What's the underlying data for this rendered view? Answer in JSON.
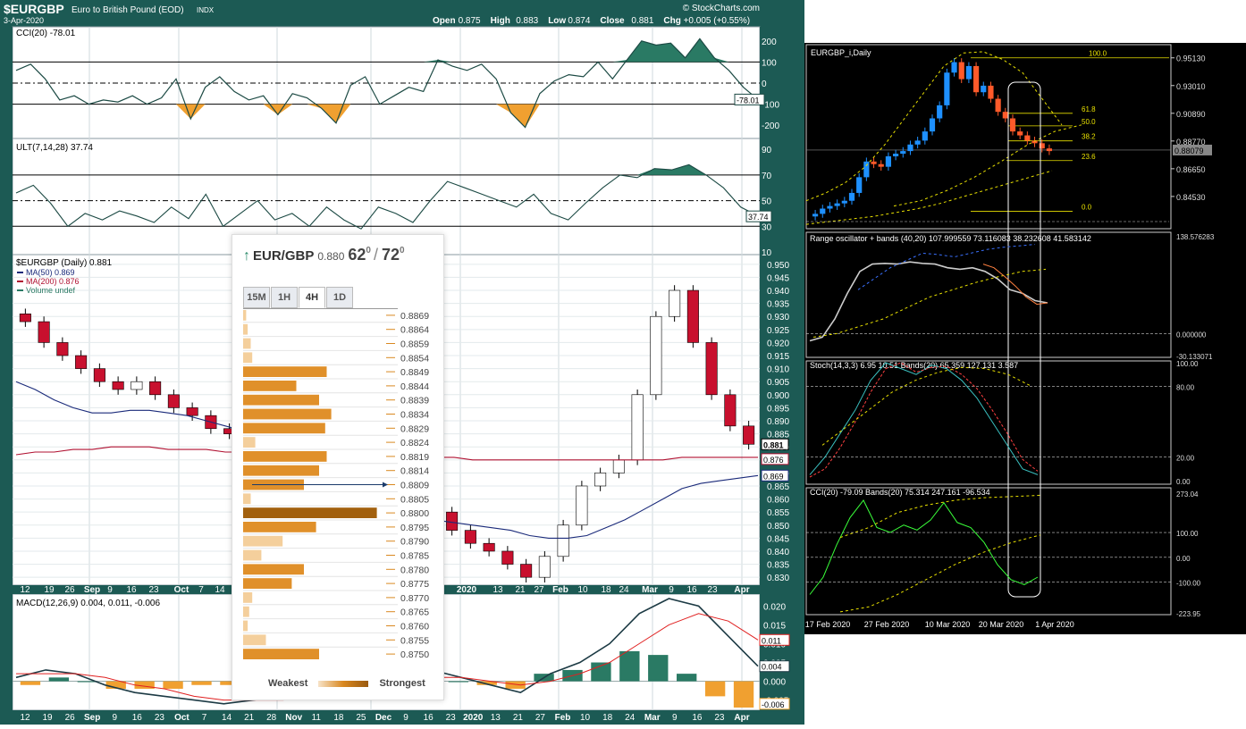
{
  "header": {
    "symbol": "$EURGBP",
    "name": "Euro to British Pound (EOD)",
    "exchange": "INDX",
    "date": "3-Apr-2020",
    "open_label": "Open",
    "open": "0.875",
    "high_label": "High",
    "high": "0.883",
    "low_label": "Low",
    "low": "0.874",
    "close_label": "Close",
    "close": "0.881",
    "chg_label": "Chg",
    "chg": "+0.005 (+0.55%)",
    "watermark": "© StockCharts.com"
  },
  "cci_panel": {
    "label": "CCI(20) -78.01",
    "ticks": [
      "200",
      "100",
      "0",
      "-100",
      "-200"
    ],
    "value_tag": "-78.01"
  },
  "ult_panel": {
    "label": "ULT(7,14,28) 37.74",
    "ticks": [
      "90",
      "70",
      "50",
      "30",
      "10"
    ],
    "value_tag": "37.74"
  },
  "price_panel": {
    "label": "$EURGBP (Daily) 0.881",
    "legend": [
      "MA(50) 0.869",
      "MA(200) 0.876",
      "Volume undef"
    ],
    "ticks": [
      "0.950",
      "0.945",
      "0.940",
      "0.935",
      "0.930",
      "0.925",
      "0.920",
      "0.915",
      "0.910",
      "0.905",
      "0.900",
      "0.895",
      "0.890",
      "0.885",
      "0.880",
      "0.875",
      "0.870",
      "0.865",
      "0.860",
      "0.855",
      "0.850",
      "0.845",
      "0.840",
      "0.835",
      "0.830"
    ],
    "tags": [
      "0.881",
      "0.876",
      "0.869"
    ]
  },
  "x_axis": {
    "labels": [
      "12",
      "19",
      "26",
      "Sep",
      "9",
      "16",
      "23",
      "Oct",
      "7",
      "14",
      "2020",
      "13",
      "21",
      "27",
      "Feb",
      "10",
      "18",
      "24",
      "Mar",
      "9",
      "16",
      "23",
      "Apr"
    ],
    "bottom_labels": [
      "12",
      "19",
      "26",
      "Sep",
      "9",
      "16",
      "23",
      "Oct",
      "7",
      "14",
      "21",
      "28",
      "Nov",
      "11",
      "18",
      "25",
      "Dec",
      "9",
      "16",
      "23",
      "2020",
      "13",
      "21",
      "27",
      "Feb",
      "10",
      "18",
      "24",
      "Mar",
      "9",
      "16",
      "23",
      "Apr"
    ]
  },
  "macd_panel": {
    "label": "MACD(12,26,9) 0.004, 0.011, -0.006",
    "ticks": [
      "0.020",
      "0.015",
      "0.010",
      "0.005",
      "0.000",
      "-0.005"
    ],
    "tags": [
      "0.011",
      "0.004",
      "-0.006"
    ]
  },
  "popup": {
    "pair": "EUR/GBP",
    "price": "0.880",
    "score_a": "62",
    "score_a_sup": "0",
    "score_b": "72",
    "score_b_sup": "0",
    "tabs": [
      "15M",
      "1H",
      "4H",
      "1D"
    ],
    "active_tab": "4H",
    "levels": [
      "0.8869",
      "0.8864",
      "0.8859",
      "0.8854",
      "0.8849",
      "0.8844",
      "0.8839",
      "0.8834",
      "0.8829",
      "0.8824",
      "0.8819",
      "0.8814",
      "0.8809",
      "0.8805",
      "0.8800",
      "0.8795",
      "0.8790",
      "0.8785",
      "0.8780",
      "0.8775",
      "0.8770",
      "0.8765",
      "0.8760",
      "0.8755",
      "0.8750"
    ],
    "strength": [
      0.02,
      0.03,
      0.05,
      0.06,
      0.55,
      0.35,
      0.5,
      0.58,
      0.54,
      0.08,
      0.55,
      0.5,
      0.4,
      0.05,
      0.88,
      0.48,
      0.26,
      0.12,
      0.4,
      0.32,
      0.06,
      0.04,
      0.03,
      0.15,
      0.5
    ],
    "weakest": "Weakest",
    "strongest": "Strongest"
  },
  "mt_main": {
    "title": "EURGBP_i,Daily",
    "ticks": [
      "0.95130",
      "0.93010",
      "0.90890",
      "0.88770",
      "0.86650",
      "0.84530"
    ],
    "price_tag": "0.88079",
    "fib_labels": [
      "100.0",
      "61.8",
      "50.0",
      "38.2",
      "23.6",
      "0.0"
    ]
  },
  "mt_range": {
    "label": "Range oscillator + bands (40,20) 107.999559 73.116083 38.232608 41.583142",
    "ticks": [
      "138.576283",
      "0.000000",
      "-30.133071"
    ]
  },
  "mt_stoch": {
    "label": "Stoch(14,3,3) 6.95 10.51 Bands(20) 65.359 127.131 3.587",
    "ticks": [
      "100.00",
      "80.00",
      "20.00",
      "0.00"
    ]
  },
  "mt_cci": {
    "label": "CCI(20) -79.09 Bands(20) 75.314 247.161 -96.534",
    "ticks": [
      "273.04",
      "100.00",
      "0.00",
      "-100.00",
      "-223.95"
    ]
  },
  "mt_dates": [
    "17 Feb 2020",
    "27 Feb 2020",
    "10 Mar 2020",
    "20 Mar 2020",
    "1 Apr 2020"
  ],
  "colors": {
    "up": "#ffffff",
    "down": "#c8102e",
    "ma50": "#1a2a7a",
    "ma200": "#b01030",
    "cci_fill_up": "#2a7a64",
    "cci_fill_dn": "#f0a030",
    "mt_up": "#1e90ff",
    "mt_down": "#ff5a2a"
  },
  "chart_data": [
    {
      "type": "line",
      "title": "$EURGBP (Daily) 0.881",
      "series": [
        {
          "name": "$EURGBP",
          "values": [
            0.928,
            0.92,
            0.915,
            0.91,
            0.905,
            0.902,
            0.905,
            0.9,
            0.895,
            0.892,
            0.887,
            0.885,
            0.883,
            0.885,
            0.889,
            0.895,
            0.875,
            0.862,
            0.86,
            0.858,
            0.855,
            0.852,
            0.855,
            0.848,
            0.843,
            0.84,
            0.835,
            0.83,
            0.838,
            0.85,
            0.865,
            0.87,
            0.875,
            0.9,
            0.93,
            0.94,
            0.92,
            0.9,
            0.888,
            0.881
          ]
        },
        {
          "name": "MA(50)",
          "values": [
            0.905,
            0.902,
            0.898,
            0.895,
            0.893,
            0.893,
            0.894,
            0.894,
            0.893,
            0.892,
            0.89,
            0.888,
            0.886,
            0.884,
            0.882,
            0.878,
            0.872,
            0.866,
            0.861,
            0.858,
            0.855,
            0.853,
            0.852,
            0.851,
            0.85,
            0.849,
            0.848,
            0.846,
            0.845,
            0.845,
            0.846,
            0.849,
            0.852,
            0.856,
            0.86,
            0.864,
            0.866,
            0.867,
            0.868,
            0.869
          ]
        },
        {
          "name": "MA(200)",
          "values": [
            0.877,
            0.878,
            0.878,
            0.879,
            0.879,
            0.88,
            0.88,
            0.88,
            0.879,
            0.879,
            0.879,
            0.878,
            0.878,
            0.878,
            0.878,
            0.878,
            0.877,
            0.877,
            0.877,
            0.876,
            0.876,
            0.876,
            0.876,
            0.876,
            0.875,
            0.875,
            0.875,
            0.875,
            0.875,
            0.875,
            0.875,
            0.875,
            0.875,
            0.875,
            0.875,
            0.876,
            0.876,
            0.876,
            0.876,
            0.876
          ]
        }
      ],
      "ylim": [
        0.828,
        0.952
      ]
    },
    {
      "type": "line",
      "title": "CCI(20) -78.01",
      "series": [
        {
          "name": "CCI(20)",
          "values": [
            60,
            90,
            20,
            -80,
            -60,
            -100,
            -80,
            -90,
            -60,
            -100,
            -70,
            20,
            -170,
            -20,
            30,
            -40,
            -80,
            -60,
            -150,
            -50,
            -70,
            -120,
            -190,
            -10,
            30,
            -100,
            -60,
            -20,
            -40,
            110,
            80,
            60,
            90,
            20,
            -140,
            -210,
            -50,
            10,
            40,
            30,
            100,
            20,
            110,
            200,
            180,
            190,
            120,
            210,
            120,
            60,
            -20,
            -78
          ]
        }
      ],
      "ylim": [
        -250,
        250
      ]
    },
    {
      "type": "line",
      "title": "ULT(7,14,28) 37.74",
      "series": [
        {
          "name": "ULT",
          "values": [
            56,
            62,
            48,
            30,
            40,
            35,
            42,
            38,
            33,
            45,
            36,
            55,
            30,
            40,
            50,
            35,
            40,
            30,
            45,
            35,
            28,
            45,
            40,
            33,
            50,
            65,
            60,
            55,
            50,
            45,
            55,
            40,
            35,
            48,
            60,
            70,
            68,
            75,
            74,
            78,
            70,
            60,
            45,
            38
          ]
        }
      ],
      "ylim": [
        10,
        95
      ]
    },
    {
      "type": "bar",
      "title": "MACD(12,26,9) 0.004, 0.011, -0.006",
      "series": [
        {
          "name": "MACD",
          "values": [
            0.001,
            0.003,
            0.002,
            -0.001,
            -0.003,
            -0.004,
            -0.005,
            -0.006,
            -0.005,
            -0.004,
            -0.002,
            -0.004,
            -0.002,
            0.002,
            0.003,
            0.001,
            -0.001,
            -0.003,
            0.002,
            0.005,
            0.01,
            0.018,
            0.022,
            0.02,
            0.012,
            0.004
          ]
        },
        {
          "name": "Signal",
          "values": [
            0.002,
            0.002,
            0.002,
            0.001,
            -0.001,
            -0.002,
            -0.004,
            -0.005,
            -0.005,
            -0.005,
            -0.004,
            -0.004,
            -0.003,
            -0.001,
            0.001,
            0.001,
            0.0,
            -0.001,
            0.0,
            0.002,
            0.005,
            0.01,
            0.015,
            0.018,
            0.016,
            0.011
          ]
        }
      ],
      "ylim": [
        -0.007,
        0.022
      ]
    }
  ]
}
